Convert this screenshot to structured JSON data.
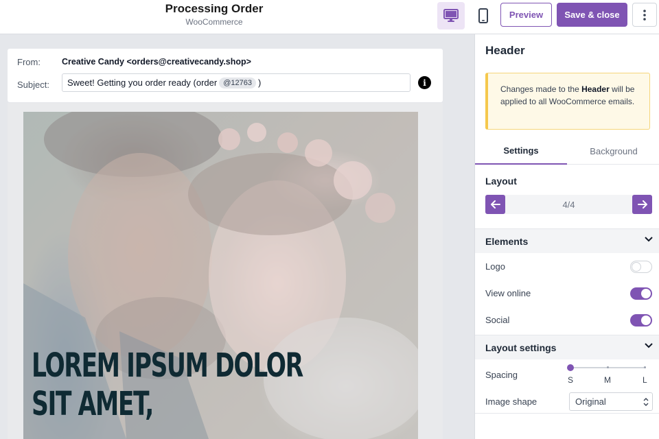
{
  "header": {
    "title": "Processing Order",
    "subtitle": "WooCommerce",
    "device_desktop_icon": "desktop-icon",
    "device_mobile_icon": "mobile-icon",
    "preview_label": "Preview",
    "save_label": "Save & close",
    "more_icon": "more-vertical-icon"
  },
  "email": {
    "from_label": "From:",
    "from_value": "Creative Candy <orders@creativecandy.shop>",
    "subject_label": "Subject:",
    "subject_prefix": "Sweet! Getting you order ready (order",
    "subject_tag": "@12763",
    "subject_suffix": ")",
    "headline_line1": "Lorem ipsum dolor",
    "headline_line2": "sit amet,"
  },
  "panel": {
    "title": "Header",
    "notice_pre": "Changes made to the ",
    "notice_bold": "Header",
    "notice_post": " will be applied to all WooCommerce emails.",
    "tabs": [
      {
        "label": "Settings",
        "active": true
      },
      {
        "label": "Background",
        "active": false
      }
    ],
    "layout_label": "Layout",
    "layout_value": "4/4",
    "elements_label": "Elements",
    "options": [
      {
        "label": "Logo",
        "enabled": false
      },
      {
        "label": "View online",
        "enabled": true
      },
      {
        "label": "Social",
        "enabled": true
      }
    ],
    "layout_settings_label": "Layout settings",
    "spacing_label": "Spacing",
    "spacing_options": [
      "S",
      "M",
      "L"
    ],
    "spacing_selected": "S",
    "image_shape_label": "Image shape",
    "image_shape_value": "Original"
  },
  "colors": {
    "accent": "#7f54b3",
    "notice_bg": "#fef9e7",
    "notice_border": "#f5c84c",
    "headline": "#0f2a33"
  }
}
